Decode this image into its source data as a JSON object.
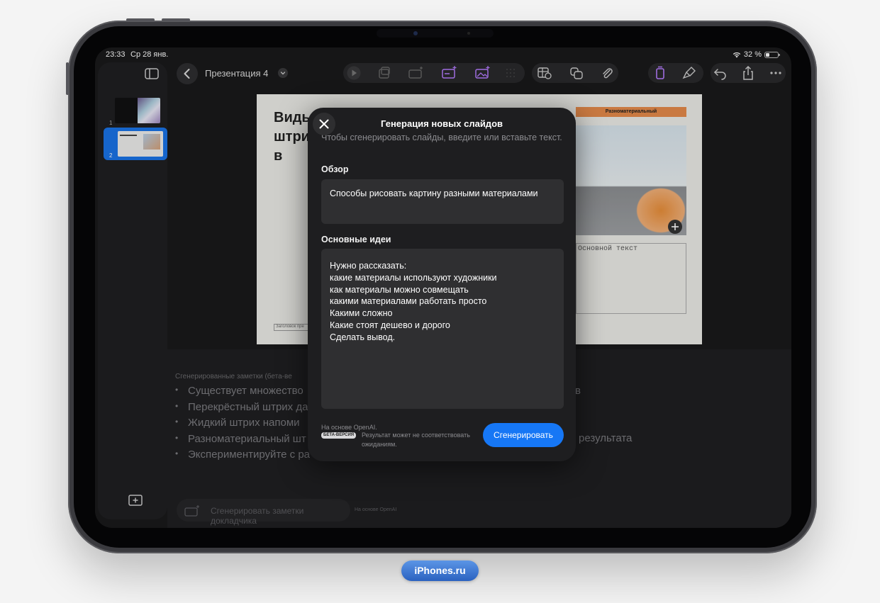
{
  "status_bar": {
    "time": "23:33",
    "date": "Ср 28 янв.",
    "battery": "32 %"
  },
  "toolbar": {
    "document_title": "Презентация 4"
  },
  "slide_panel": {
    "thumbnails": [
      {
        "number": "1"
      },
      {
        "number": "2"
      }
    ]
  },
  "slide": {
    "title": "Виды штри в",
    "banner": "Разноматериальный",
    "body_placeholder": "Основной текст",
    "footer_placeholder": "Заголовок пре"
  },
  "notes": {
    "heading": "Сгенерированные заметки (бета-ве",
    "items": [
      "Существует множество",
      "Перекрёстный штрих да",
      "Жидкий штрих напоми",
      "Разноматериальный шт",
      "Экспериментируйте с ра"
    ],
    "tail_1": "в",
    "tail_2": "результата",
    "generate_button": "Сгенерировать заметки докладчика",
    "source_note": "На основе OpenAI"
  },
  "modal": {
    "title": "Генерация новых слайдов",
    "description": "Чтобы сгенерировать слайды, введите или вставьте текст.",
    "overview_label": "Обзор",
    "overview_value": "Способы рисовать картину разными материалами",
    "ideas_label": "Основные идеи",
    "ideas_value": "Нужно рассказать:\nкакие материалы используют художники\nкак материалы можно совмещать\nкакими материалами работать просто\nКакими сложно\nКакие стоят дешево и дорого\nСделать вывод.",
    "source": "На основе OpenAI.",
    "beta_badge": "БЕТА-ВЕРСИЯ",
    "beta_note": "Результат может не соответствовать ожиданиям.",
    "generate_label": "Сгенерировать"
  },
  "watermark": {
    "text": "iPhones.ru"
  },
  "colors": {
    "accent": "#1677f5",
    "selection": "#1a73e8",
    "modal_bg": "#1e1e20",
    "field_bg": "#2f2f31"
  },
  "icons": [
    "sidebar-toggle-icon",
    "chevron-left-icon",
    "chevron-down-icon",
    "play-icon",
    "animate-icon",
    "slide-add-icon",
    "text-box-icon",
    "image-add-icon",
    "grid-icon",
    "table-icon",
    "shapes-icon",
    "paperclip-icon",
    "format-icon",
    "brush-icon",
    "undo-icon",
    "share-icon",
    "more-icon",
    "close-icon",
    "add-slide-icon",
    "wifi-icon",
    "battery-icon",
    "plus-icon"
  ]
}
